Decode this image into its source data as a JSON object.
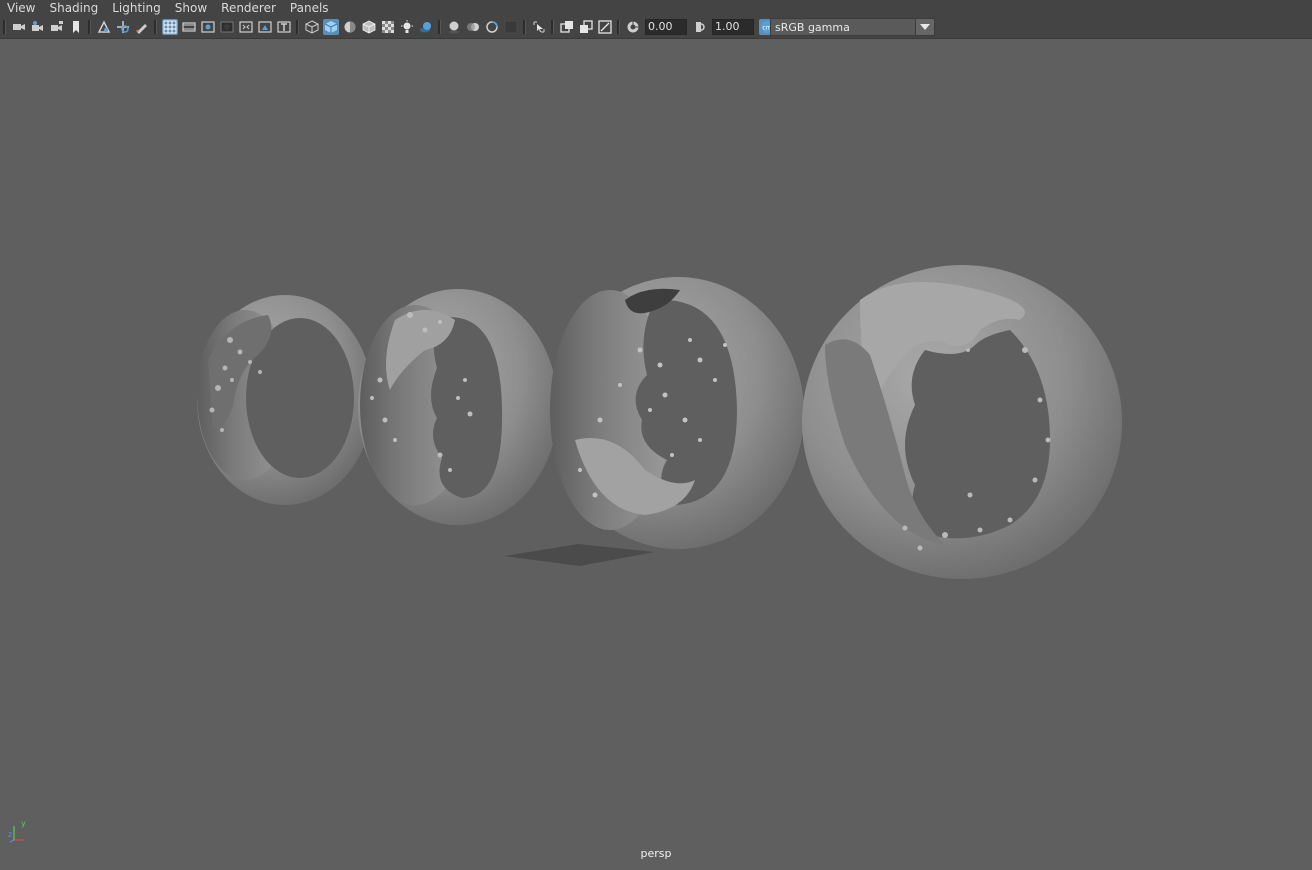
{
  "menubar": {
    "items": [
      "View",
      "Shading",
      "Lighting",
      "Show",
      "Renderer",
      "Panels"
    ]
  },
  "toolbar": {
    "exposure_value": "0.00",
    "gamma_value": "1.00",
    "color_space": "sRGB gamma",
    "icons": [
      "select-camera-icon",
      "camera-attributes-icon",
      "bookmarks-icon",
      "bookmark-icon",
      "image-plane-icon",
      "2d-pan-zoom-icon",
      "grease-pencil-icon",
      "grid-icon",
      "film-gate-icon",
      "resolution-gate-icon",
      "gate-mask-icon",
      "field-chart-icon",
      "safe-action-icon",
      "safe-title-icon",
      "wireframe-icon",
      "smooth-shade-icon",
      "use-default-material-icon",
      "wireframe-on-shaded-icon",
      "xray-icon",
      "use-all-lights-icon",
      "shadows-icon",
      "screen-space-ao-icon",
      "motion-blur-icon",
      "multisample-aa-icon",
      "depth-of-field-icon",
      "isolate-select-icon",
      "xray-active-components-icon",
      "xray-joints-icon",
      "backface-culling-icon",
      "exposure-icon",
      "gamma-icon",
      "color-management-icon"
    ]
  },
  "viewport": {
    "camera_label": "persp",
    "axis": {
      "x": "x",
      "y": "y",
      "z": "z"
    }
  },
  "colors": {
    "viewport_bg": "#5f5f5f",
    "menubar_bg": "#444444",
    "active_button": "#5d8fb5",
    "mesh": "#8f8f8f"
  }
}
